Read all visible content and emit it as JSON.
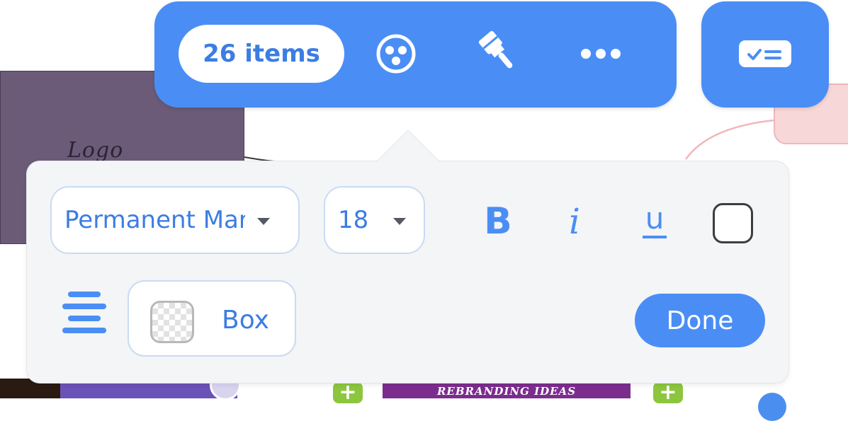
{
  "canvas": {
    "logo_card_text": "Logo",
    "rebranding_banner": "REBRANDING IDEAS",
    "plus_glyph": "+"
  },
  "toolbar": {
    "selection_count": "26 items",
    "icons": {
      "group": "group-icon",
      "style": "paintbrush-icon",
      "more": "more-options-icon",
      "card": "card-checklist-icon"
    },
    "accent_color": "#4a8ef5"
  },
  "format_panel": {
    "font_family_value": "Permanent Marker",
    "font_size_value": "18",
    "bold_label": "B",
    "italic_label": "i",
    "underline_label": "u",
    "text_color_swatch": "#ffffff",
    "align_icon": "align-center-icon",
    "box_label": "Box",
    "done_label": "Done"
  }
}
